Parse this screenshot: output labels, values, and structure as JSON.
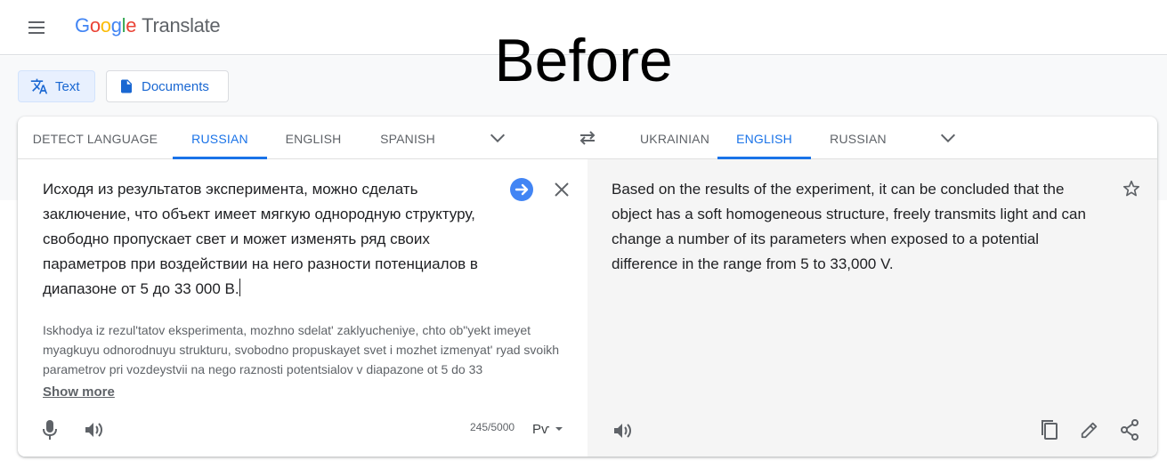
{
  "app": {
    "logo_google": [
      "G",
      "o",
      "o",
      "g",
      "l",
      "e"
    ],
    "logo_product": "Translate",
    "overlay_label": "Before"
  },
  "modes": {
    "text_label": "Text",
    "documents_label": "Documents"
  },
  "source_langs": {
    "tabs": [
      "DETECT LANGUAGE",
      "RUSSIAN",
      "ENGLISH",
      "SPANISH"
    ],
    "selected": "RUSSIAN"
  },
  "target_langs": {
    "tabs": [
      "UKRAINIAN",
      "ENGLISH",
      "RUSSIAN"
    ],
    "selected": "ENGLISH"
  },
  "source": {
    "text": "Исходя из результатов эксперимента, можно сделать заключение, что объект имеет мягкую однородную структуру, свободно пропускает свет и может изменять ряд своих параметров при воздействии на него разности потенциалов в диапазоне от 5 до 33 000 В.",
    "transliteration": "Iskhodya iz rezul'tatov eksperimenta, mozhno sdelat' zaklyucheniye, chto ob\"yekt imeyet myagkuyu odnorodnuyu strukturu, svobodno propuskayet svet i mozhet izmenyat' ryad svoikh parametrov pri vozdeystvii na nego raznosti potentsialov v diapazone ot 5 do 33",
    "show_more": "Show more",
    "char_count": "245/5000",
    "keyboard_label": "Рѵ"
  },
  "target": {
    "text": "Based on the results of the experiment, it can be concluded that the object has a soft homogeneous structure, freely transmits light and can change a number of its parameters when exposed to a potential difference in the range from 5 to 33,000 V."
  },
  "colors": {
    "accent": "#1a73e8",
    "active_mode_bg": "#e8f0fe",
    "target_bg": "#f5f5f5"
  }
}
